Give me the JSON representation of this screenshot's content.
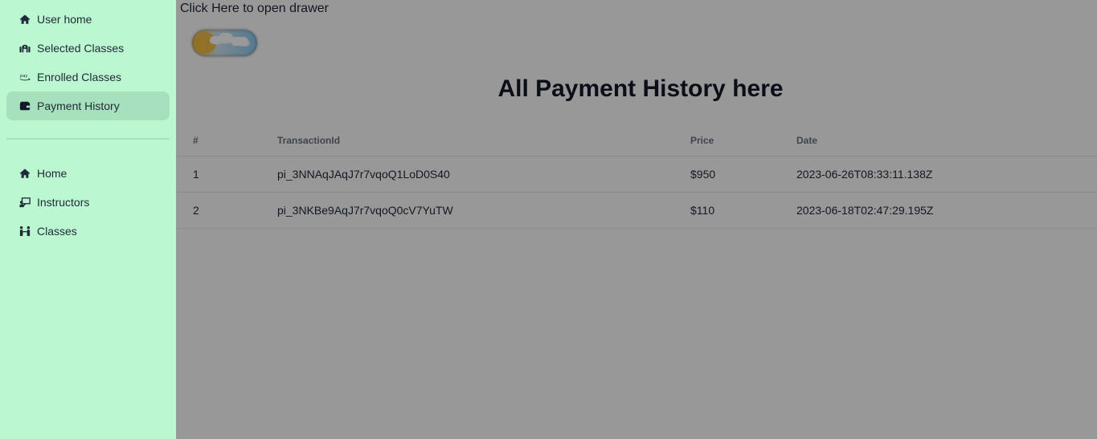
{
  "sidebar": {
    "top_items": [
      {
        "label": "User home",
        "icon": "home-icon",
        "active": false
      },
      {
        "label": "Selected Classes",
        "icon": "selected-classes-icon",
        "active": false
      },
      {
        "label": "Enrolled Classes",
        "icon": "pay-icon",
        "active": false
      },
      {
        "label": "Payment History",
        "icon": "wallet-icon",
        "active": true
      }
    ],
    "bottom_items": [
      {
        "label": "Home",
        "icon": "home-icon"
      },
      {
        "label": "Instructors",
        "icon": "instructor-icon"
      },
      {
        "label": "Classes",
        "icon": "classes-icon"
      }
    ]
  },
  "main": {
    "drawer_link": "Click Here to open drawer",
    "title": "All Payment History here"
  },
  "table": {
    "headers": [
      "#",
      "TransactionId",
      "Price",
      "Date"
    ],
    "rows": [
      {
        "index": "1",
        "transaction_id": "pi_3NNAqJAqJ7r7vqoQ1LoD0S40",
        "price": "$950",
        "date": "2023-06-26T08:33:11.138Z"
      },
      {
        "index": "2",
        "transaction_id": "pi_3NKBe9AqJ7r7vqoQ0cV7YuTW",
        "price": "$110",
        "date": "2023-06-18T02:47:29.195Z"
      }
    ]
  },
  "colors": {
    "sidebar_bg": "#bbf7d0",
    "active_item_bg": "#a7e0bd",
    "overlay": "rgba(0,0,0,0.40)"
  }
}
